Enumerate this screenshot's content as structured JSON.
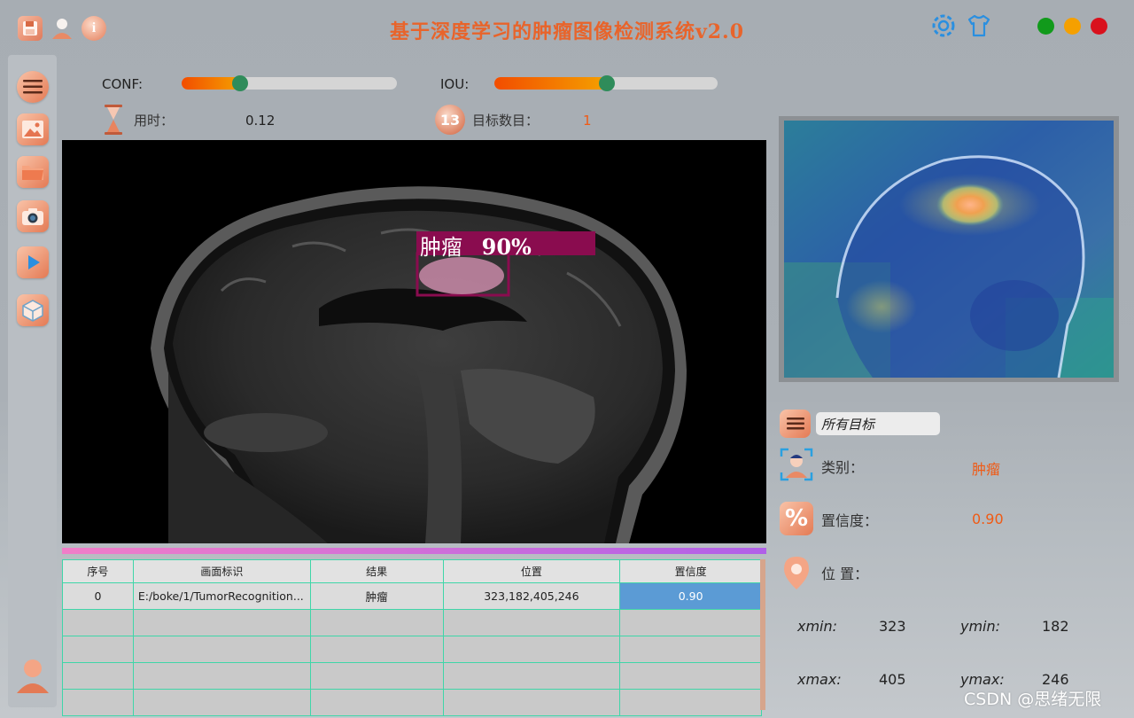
{
  "app": {
    "title": "基于深度学习的肿瘤图像检测系统v2.0"
  },
  "titlebar": {
    "left_icons": [
      "save-icon",
      "user-icon",
      "info-icon"
    ],
    "right_icons": [
      "settings-icon",
      "shirt-icon"
    ],
    "window_controls": [
      {
        "name": "minimize",
        "color": "#119a1b"
      },
      {
        "name": "maximize",
        "color": "#f5a000"
      },
      {
        "name": "close",
        "color": "#d9111d"
      }
    ]
  },
  "nav": {
    "items": [
      "menu-icon",
      "image-icon",
      "folder-icon",
      "camera-icon",
      "video-icon",
      "model-icon"
    ],
    "bottom": "user-avatar-icon"
  },
  "controls": {
    "conf": {
      "label": "CONF:",
      "value": 0.25
    },
    "iou": {
      "label": "IOU:",
      "value": 0.5
    },
    "time": {
      "label": "用时：",
      "value": "0.12"
    },
    "count": {
      "label": "目标数目：",
      "value": "1"
    }
  },
  "detection": {
    "label": "肿瘤",
    "conf_text": "90%"
  },
  "table": {
    "headers": [
      "序号",
      "画面标识",
      "结果",
      "位置",
      "置信度"
    ],
    "rows": [
      [
        "0",
        "E:/boke/1/TumorRecognition...",
        "肿瘤",
        "323,182,405,246",
        "0.90"
      ]
    ],
    "empty_rows": 4
  },
  "details": {
    "target_select": "所有目标",
    "class_label": "类别：",
    "class_value": "肿瘤",
    "conf_label": "置信度：",
    "conf_value": "0.90",
    "pos_label": "位 置：",
    "xmin_label": "xmin:",
    "xmin": "323",
    "ymin_label": "ymin:",
    "ymin": "182",
    "xmax_label": "xmax:",
    "xmax": "405",
    "ymax_label": "ymax:",
    "ymax": "246"
  },
  "watermark": "CSDN @思绪无限",
  "colors": {
    "accent": "#f05a14",
    "title": "#e8642b",
    "table_grid": "#3fd6a8",
    "selected": "#5b9bd5"
  }
}
